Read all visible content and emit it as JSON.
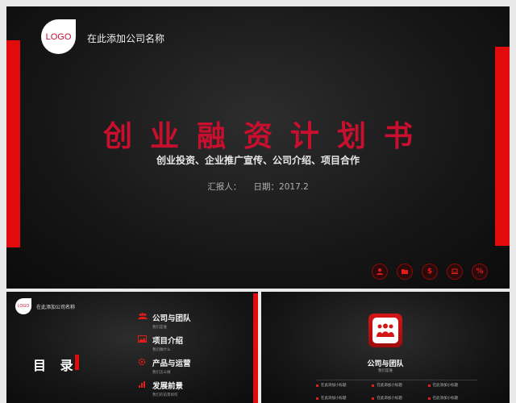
{
  "main_slide": {
    "logo": "LOGO",
    "company_name": "在此添加公司名称",
    "title": "创业融资计划书",
    "subtitle": "创业投资、企业推广宣传、公司介绍、项目合作",
    "reporter_label": "汇报人：",
    "date_label": "日期：2017.2",
    "icons": [
      "user-icon",
      "folder-icon",
      "dollar-icon",
      "laptop-icon",
      "percent-icon"
    ],
    "accent_color": "#e10b0b",
    "title_color": "#c8102e"
  },
  "toc_slide": {
    "logo": "LOGO",
    "company_name": "在此添加公司名称",
    "title": "目 录",
    "items": [
      {
        "title": "公司与团队",
        "subtitle": "我们是谁",
        "icon": "team-icon"
      },
      {
        "title": "项目介绍",
        "subtitle": "我们做什么",
        "icon": "image-icon"
      },
      {
        "title": "产品与运营",
        "subtitle": "我们怎么做",
        "icon": "gear-icon"
      },
      {
        "title": "发展前景",
        "subtitle": "我们的前景如何",
        "icon": "chart-icon"
      }
    ]
  },
  "section_slide": {
    "title": "公司与团队",
    "subtitle": "我们是谁",
    "icon": "team-icon",
    "cells": [
      "在此添加小标题",
      "在此添加小标题",
      "在此添加小标题",
      "在此添加小标题",
      "在此添加小标题",
      "在此添加小标题"
    ]
  }
}
